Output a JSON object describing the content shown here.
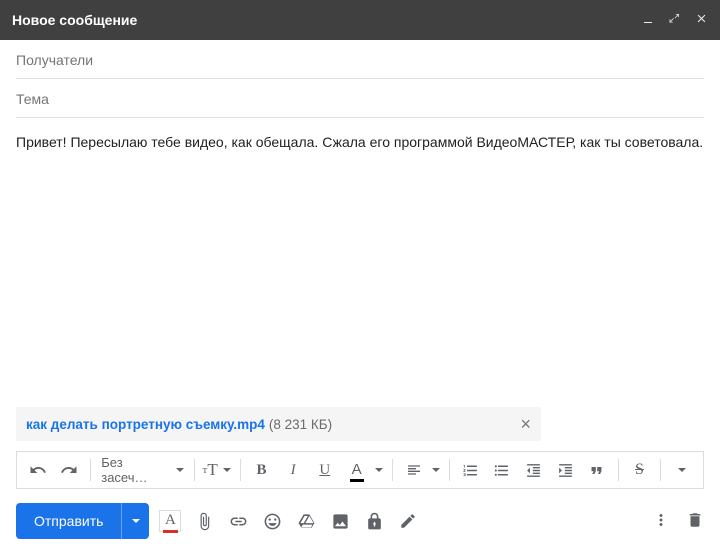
{
  "titlebar": {
    "title": "Новое сообщение"
  },
  "fields": {
    "recipients_placeholder": "Получатели",
    "subject_placeholder": "Тема"
  },
  "body": {
    "text": "Привет! Пересылаю тебе видео, как обещала. Сжала его программой ВидеоМАСТЕР, как ты советовала."
  },
  "attachment": {
    "filename": "как делать портретную съемку.mp4",
    "size_label": "(8 231 КБ)"
  },
  "format_toolbar": {
    "font_family_label": "Без засеч…",
    "size_glyph": "тТ",
    "bold_glyph": "B",
    "italic_glyph": "I",
    "underline_glyph": "U",
    "textcolor_glyph": "A",
    "strike_glyph": "S"
  },
  "send": {
    "label": "Отправить"
  },
  "bottom_toolbar": {
    "format_glyph": "A"
  }
}
